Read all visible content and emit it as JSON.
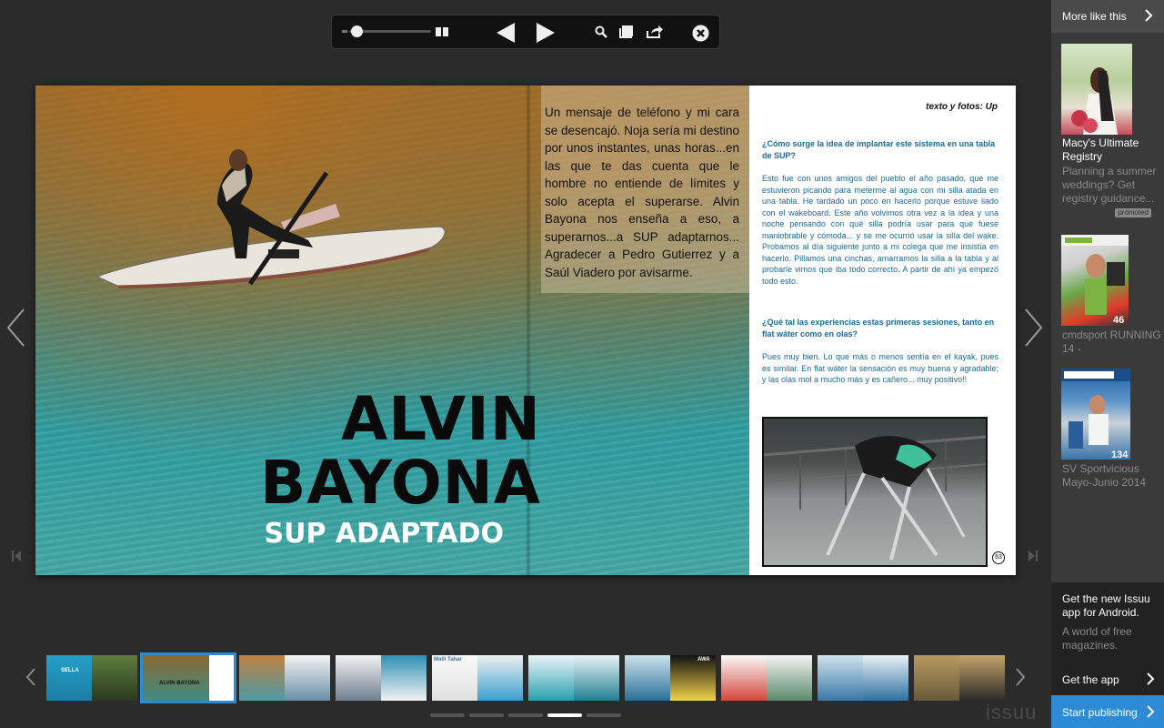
{
  "toolbar": {
    "icons": [
      "grid-view-icon",
      "prev-page-icon",
      "next-page-icon",
      "search-icon",
      "library-icon",
      "share-icon",
      "close-icon"
    ],
    "zoom_level": 0.05
  },
  "article": {
    "intro": "Un mensaje de teléfono y mi cara se desencajó. Noja sería mi destino por unos instantes, unas horas...en las que te das cuenta que le hombre no entiende de límites y solo acepta el superarse. Alvin Bayona nos enseña a eso, a superarnos...a SUP adaptarnos... Agradecer a Pedro Gutierrez y a Saúl Viadero por avisarme.",
    "title_line1": "ALVIN",
    "title_line2": "BAYONA",
    "subtitle": "SUP ADAPTADO",
    "credits": "texto y fotos: Up",
    "q1": "¿Cómo surge la idea de implantar este sistema en una tabla de SUP?",
    "a1": "Esto fue con unos amigos del pueblo el año pasado, que me estuvieron picando para meterme al agua con mi silla atada en una tabla. He tardado un poco en hacerlo porque estuve liado con el wakeboard. Este año volvimos otra vez a la idea y una noche pensando con qué silla podría usar para que fuese maniobrable y cómoda... y se me ocurrió usar la silla del wake. Probamos al día siguiente junto a mi colega que me insistía en hacerlo. Pillamos una cinchas, amarramos la silla a la tabla y al probarle vimos que iba todo correcto. A partir de ahí ya empezó todo esto.",
    "q2": "¿Qué tal las experiencias estas primeras sesiones, tanto en flat wáter como en olas?",
    "a2": "Pues muy bien. Lo que más o menos sentía en el kayak, pues es similar. En flat wáter la sensación es muy buena y agradable; y las olas mol a mucho más y es cañero... muy positivo!!",
    "page_number": "63"
  },
  "sidebar": {
    "header": "More like this",
    "items": [
      {
        "title": "Macy's Ultimate Registry",
        "desc": "Planning a summer weddings? Get registry guidance...",
        "badge": "promoted",
        "count": ""
      },
      {
        "title": "",
        "desc": "cmdsport RUNNING 14 -",
        "badge": "",
        "count": "46"
      },
      {
        "title": "",
        "desc": "SV Sportvicious Mayo-Junio 2014",
        "badge": "",
        "count": "134"
      }
    ],
    "android_title": "Get the new Issuu app for Android.",
    "android_desc": "A world of free magazines.",
    "get_app": "Get the app",
    "publish": "Start publishing"
  },
  "thumbnails": {
    "count": 10,
    "active_index": 1,
    "labels": [
      "SELLA",
      "ALVIN BAYONA",
      "",
      "",
      "Malli Tahar",
      "",
      "AWA",
      "",
      "",
      ""
    ]
  },
  "pager": {
    "pages": 5,
    "active": 3
  },
  "brand": "issuu",
  "colors": {
    "accent": "#2d8bd6",
    "background": "#2b2b2b",
    "sidebar": "#3a3a3a",
    "article_blue": "#1a6a9a"
  }
}
